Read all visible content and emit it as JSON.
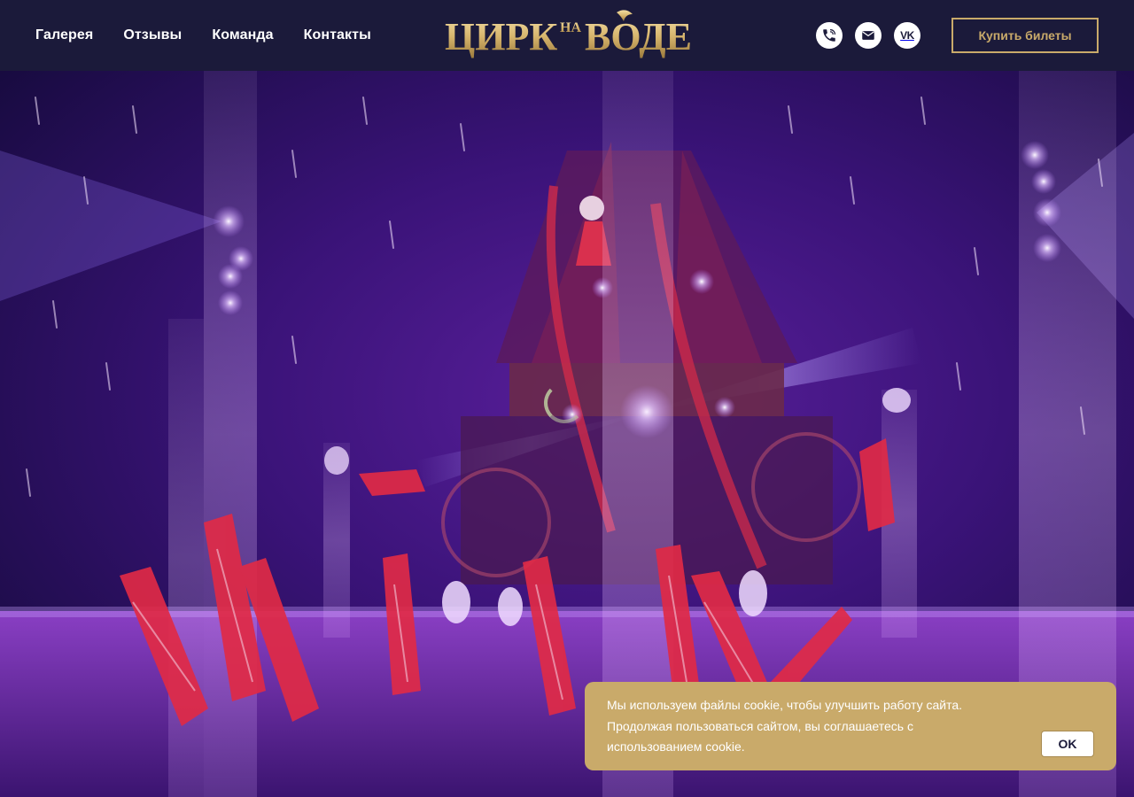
{
  "header": {
    "nav": [
      {
        "label": "Галерея"
      },
      {
        "label": "Отзывы"
      },
      {
        "label": "Команда"
      },
      {
        "label": "Контакты"
      }
    ],
    "logo": {
      "word_left": "ЦИРК",
      "word_small": "НА",
      "word_right": "ВОДЕ"
    },
    "socials": [
      {
        "icon": "phone-icon"
      },
      {
        "icon": "mail-icon"
      },
      {
        "icon": "vk-icon",
        "glyph": "VK"
      }
    ],
    "buy_label": "Купить билеты"
  },
  "cookie": {
    "text": "Мы используем файлы cookie, чтобы улучшить работу сайта. Продолжая пользоваться сайтом, вы соглашаетесь с использованием cookie.",
    "ok_label": "OK"
  },
  "colors": {
    "header_bg": "#1b1a3a",
    "accent_gold": "#c9aa6a",
    "hero_purple": "#7a2bb8"
  }
}
